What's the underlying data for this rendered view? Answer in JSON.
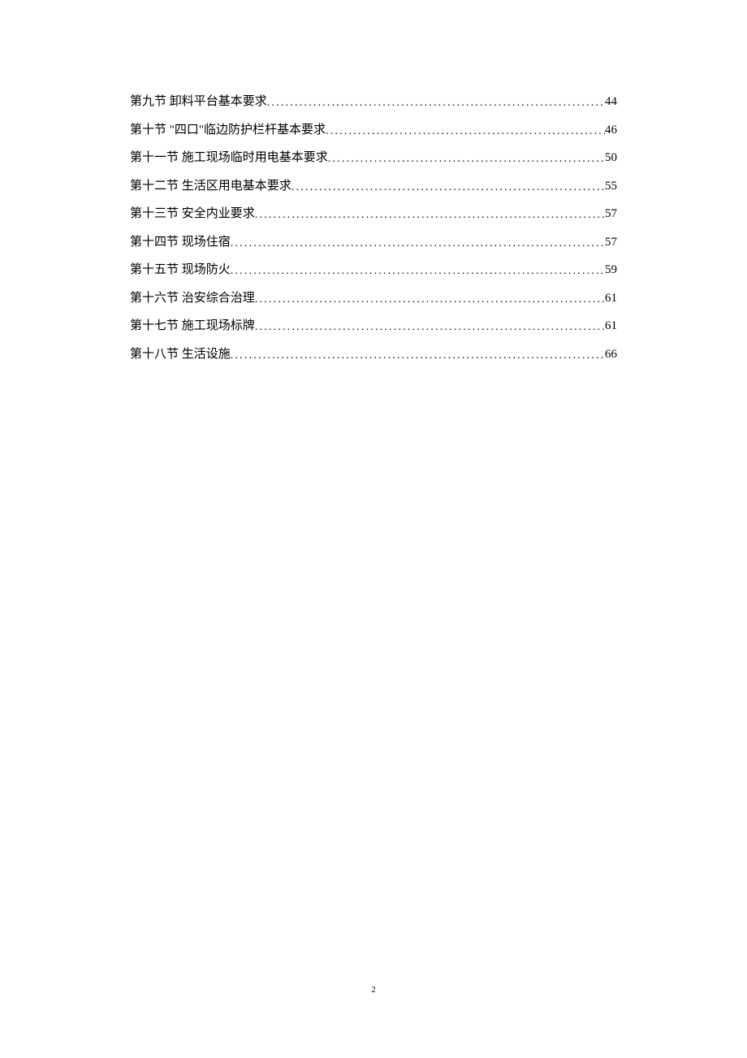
{
  "toc": {
    "entries": [
      {
        "label": "第九节 卸料平台基本要求",
        "page": "44"
      },
      {
        "label": "第十节 \"四口\"临边防护栏杆基本要求",
        "page": "46"
      },
      {
        "label": "第十一节 施工现场临时用电基本要求",
        "page": "50"
      },
      {
        "label": "第十二节 生活区用电基本要求",
        "page": "55"
      },
      {
        "label": "第十三节 安全内业要求",
        "page": "57"
      },
      {
        "label": "第十四节 现场住宿",
        "page": "57"
      },
      {
        "label": "第十五节 现场防火",
        "page": "59"
      },
      {
        "label": "第十六节 治安综合治理",
        "page": "61"
      },
      {
        "label": "第十七节 施工现场标牌",
        "page": "61"
      },
      {
        "label": "第十八节 生活设施",
        "page": "66"
      }
    ]
  },
  "footer": {
    "page_number": "2"
  }
}
